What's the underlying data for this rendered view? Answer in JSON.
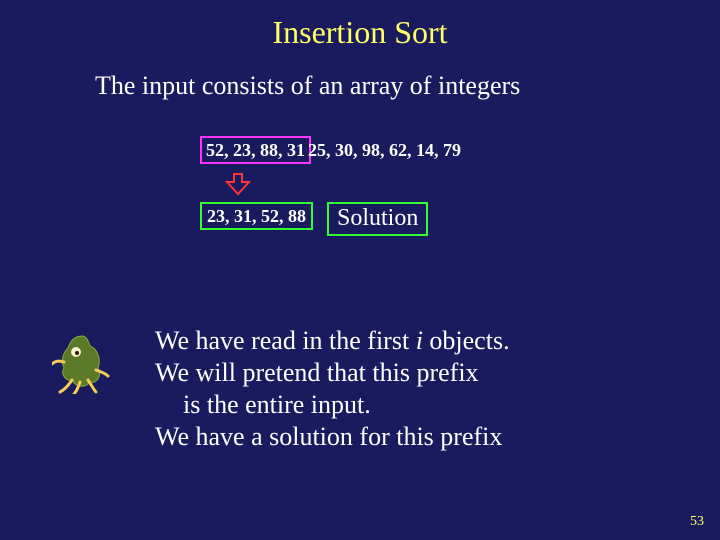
{
  "title": "Insertion Sort",
  "subtitle": "The input consists of an array of integers",
  "input_prefix": "52, 23, 88, 31",
  "input_rest": " 25, 30, 98, 62, 14, 79",
  "sorted_prefix": "23, 31, 52, 88",
  "solution_label": "Solution",
  "body": {
    "line1_a": "We have read in the first ",
    "line1_i": "i",
    "line1_b": " objects.",
    "line2": "We will pretend that this prefix",
    "line3": "is the entire input.",
    "line4": "We have a solution for this prefix"
  },
  "page_number": "53"
}
